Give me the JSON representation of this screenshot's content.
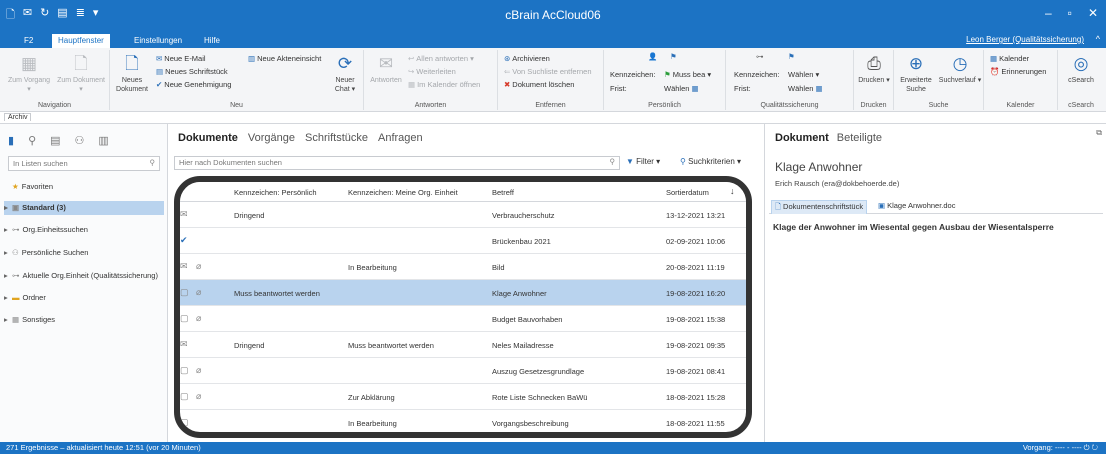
{
  "window": {
    "title": "cBrain AcCloud06",
    "quick_access_icons": [
      "new-doc-icon",
      "mail-icon",
      "refresh-icon",
      "notes-icon",
      "format-icon",
      "dropdown-icon"
    ],
    "minimize": "–",
    "maximize": "▫",
    "close": "✕"
  },
  "ribbon_tabs": {
    "f2": "F2",
    "hauptfenster": "Hauptfenster",
    "einstellungen": "Einstellungen",
    "hilfe": "Hilfe",
    "user": "Leon Berger (Qualitätssicherung)",
    "collapse": "^"
  },
  "ribbon": {
    "navigation": {
      "label": "Navigation",
      "zum_vorgang": "Zum Vorgang ▾",
      "zum_dokument": "Zum Dokument ▾"
    },
    "neu": {
      "label": "Neu",
      "neues_dokument": "Neues Dokument",
      "neue_email": "Neue E-Mail",
      "neues_schriftstueck": "Neues Schriftstück",
      "neue_genehmigung": "Neue Genehmigung",
      "neue_akteneinsicht": "Neue Akteneinsicht",
      "neuer_chat": "Neuer Chat ▾"
    },
    "antworten": {
      "label": "Antworten",
      "antworten": "Antworten",
      "allen_antworten": "Allen antworten ▾",
      "weiterleiten": "Weiterleiten",
      "im_kalender": "Im Kalender öffnen"
    },
    "entfernen": {
      "label": "Entfernen",
      "archivieren": "Archivieren",
      "von_suchliste": "Von Suchliste entfernen",
      "dokument_loeschen": "Dokument löschen"
    },
    "persoenlich": {
      "label": "Persönlich",
      "kennzeichen": "Kennzeichen:",
      "kennzeichen_value": "Muss bea ▾",
      "frist": "Frist:",
      "frist_value": "Wählen"
    },
    "qs": {
      "label": "Qualitätssicherung",
      "kennzeichen": "Kennzeichen:",
      "kennzeichen_value": "Wählen",
      "frist": "Frist:",
      "frist_value": "Wählen"
    },
    "drucken": {
      "label": "Drucken",
      "drucken": "Drucken ▾"
    },
    "suche": {
      "label": "Suche",
      "erweiterte": "Erweiterte Suche",
      "suchverlauf": "Suchverlauf ▾"
    },
    "kalender": {
      "label": "Kalender",
      "kalender": "Kalender",
      "erinnerungen": "Erinnerungen"
    },
    "csearch": {
      "label": "cSearch",
      "csearch": "cSearch"
    }
  },
  "archiv_tab": "Archiv",
  "left": {
    "search_placeholder": "In Listen suchen",
    "items": [
      {
        "label": "Favoriten",
        "icon": "star-icon"
      },
      {
        "label": "Standard (3)",
        "icon": "standard-icon"
      },
      {
        "label": "Org.Einheitssuchen",
        "icon": "org-icon"
      },
      {
        "label": "Persönliche Suchen",
        "icon": "person-search-icon"
      },
      {
        "label": "Aktuelle Org.Einheit (Qualitätssicherung)",
        "icon": "org-icon"
      },
      {
        "label": "Ordner",
        "icon": "folder-icon"
      },
      {
        "label": "Sonstiges",
        "icon": "misc-icon"
      }
    ]
  },
  "center": {
    "tabs": [
      "Dokumente",
      "Vorgänge",
      "Schriftstücke",
      "Anfragen"
    ],
    "search_placeholder": "Hier nach Dokumenten suchen",
    "filter": "Filter ▾",
    "suchkriterien": "Suchkriterien ▾",
    "columns": {
      "persoenlich": "Kennzeichen: Persönlich",
      "org": "Kennzeichen: Meine Org. Einheit",
      "betreff": "Betreff",
      "datum": "Sortierdatum",
      "sort_arrow": "↓"
    },
    "rows": [
      {
        "icon": "✉",
        "clip": "",
        "pers": "Dringend",
        "org": "",
        "betreff": "Verbraucherschutz",
        "datum": "13-12-2021 13:21"
      },
      {
        "icon": "✔",
        "clip": "",
        "pers": "",
        "org": "",
        "betreff": "Brückenbau 2021",
        "datum": "02-09-2021 10:06"
      },
      {
        "icon": "✉",
        "clip": "⌀",
        "pers": "",
        "org": "In Bearbeitung",
        "betreff": "Bild",
        "datum": "20-08-2021 11:19"
      },
      {
        "icon": "▢",
        "clip": "⌀",
        "pers": "Muss beantwortet werden",
        "org": "",
        "betreff": "Klage Anwohner",
        "datum": "19-08-2021 16:20"
      },
      {
        "icon": "▢",
        "clip": "⌀",
        "pers": "",
        "org": "",
        "betreff": "Budget Bauvorhaben",
        "datum": "19-08-2021 15:38"
      },
      {
        "icon": "✉",
        "clip": "",
        "pers": "Dringend",
        "org": "Muss beantwortet werden",
        "betreff": "Neles Mailadresse",
        "datum": "19-08-2021 09:35"
      },
      {
        "icon": "▢",
        "clip": "⌀",
        "pers": "",
        "org": "",
        "betreff": "Auszug Gesetzesgrundlage",
        "datum": "19-08-2021 08:41"
      },
      {
        "icon": "▢",
        "clip": "⌀",
        "pers": "",
        "org": "Zur Abklärung",
        "betreff": "Rote Liste Schnecken BaWü",
        "datum": "18-08-2021 15:28"
      },
      {
        "icon": "▢",
        "clip": "",
        "pers": "",
        "org": "In Bearbeitung",
        "betreff": "Vorgangsbeschreibung",
        "datum": "18-08-2021 11:55"
      }
    ]
  },
  "right": {
    "tabs": [
      "Dokument",
      "Beteiligte"
    ],
    "title": "Klage Anwohner",
    "from": "Erich Rausch (era@dokbehoerde.de)",
    "doc_tabs": [
      "Dokumentenschriftstück",
      "Klage Anwohner.doc"
    ],
    "body": "Klage der Anwohner im Wiesental gegen Ausbau der Wiesentalsperre"
  },
  "status": {
    "left": "271 Ergebnisse – aktualisiert heute 12:51 (vor 20 Minuten)",
    "right": "Vorgang: ---- - ---- ⏻ ↻"
  },
  "colors": {
    "brand_blue": "#1c73c4",
    "selection": "#b9d3ee"
  }
}
